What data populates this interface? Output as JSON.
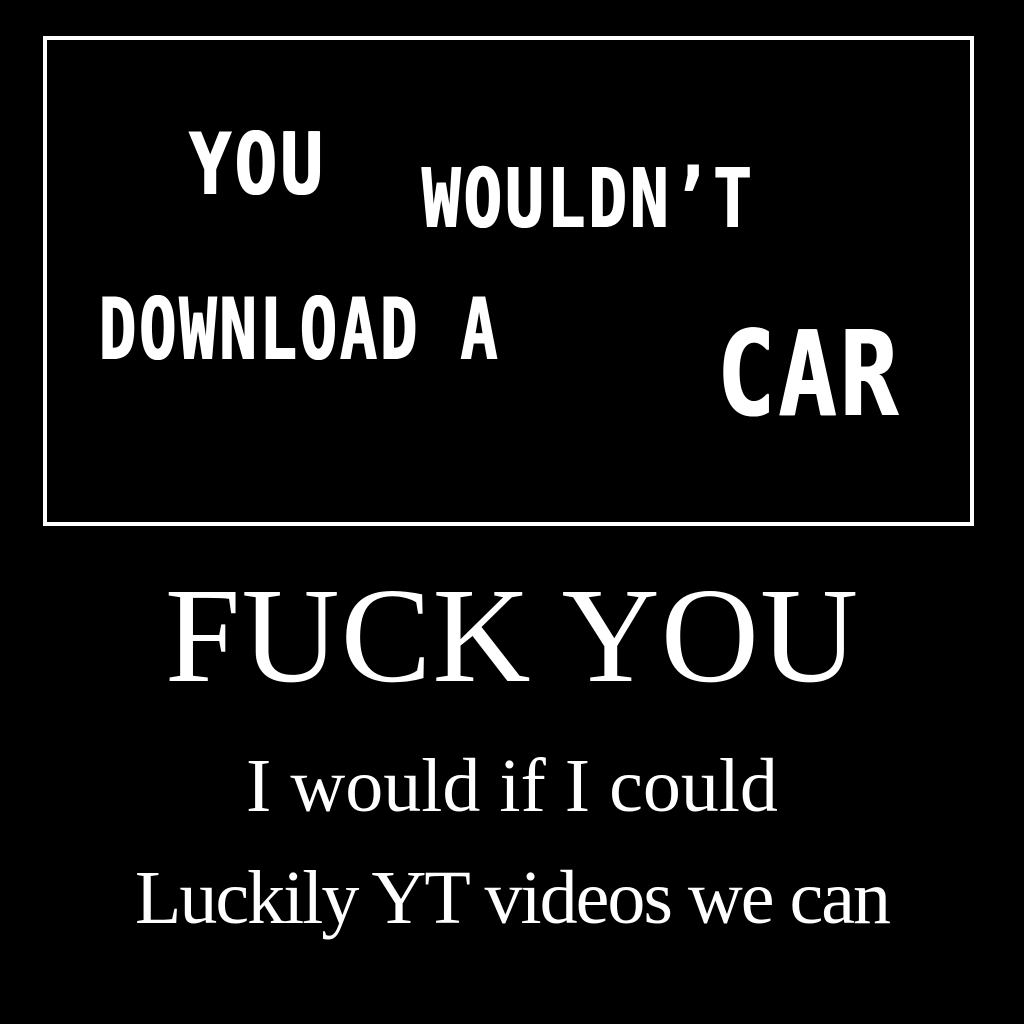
{
  "poster": {
    "line1_word1": "YOU",
    "line1_word2": "WOULDN’T",
    "line2_words": "DOWNLOAD A",
    "line2_emphasis": "CAR"
  },
  "caption": {
    "headline": "FUCK YOU",
    "line1": "I would if I could",
    "line2": "Luckily YT videos we can"
  },
  "colors": {
    "background": "#000000",
    "foreground": "#ffffff"
  }
}
